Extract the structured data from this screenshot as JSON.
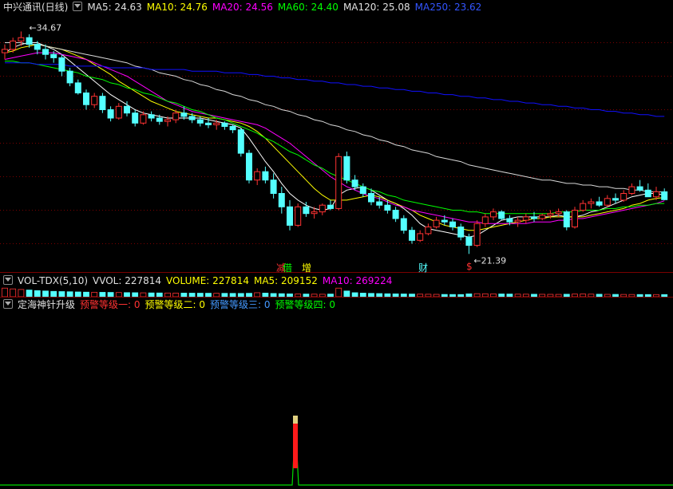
{
  "colors": {
    "ma5": "#ffff00",
    "ma10": "#ffff00",
    "ma20": "#ff00ff",
    "ma60": "#00ff00",
    "ma120": "#d0d0d0",
    "ma250": "#0000ff",
    "up": "#ff3232",
    "down": "#54ffff",
    "grid": "#7a0000"
  },
  "main_panel": {
    "stock_name": "中兴通讯(日线)",
    "ma5": "MA5: 24.63",
    "ma10": "MA10: 24.76",
    "ma20": "MA20: 24.56",
    "ma60": "MA60: 24.40",
    "ma120": "MA120: 25.08",
    "ma250": "MA250: 23.62",
    "high_label": "34.67",
    "low_label": "21.39",
    "markers": [
      "减",
      "借",
      "增",
      "财",
      "$"
    ]
  },
  "vol_panel": {
    "title": "VOL-TDX(5,10)",
    "vvol": "VVOL: 227814",
    "volume": "VOLUME: 227814",
    "ma5": "MA5: 209152",
    "ma10": "MA10: 269224"
  },
  "ind_panel": {
    "title": "定海神针升级",
    "w1": "预警等级一: 0",
    "w2": "预警等级二: 0",
    "w3": "预警等级三: 0",
    "w4": "预警等级四: 0"
  },
  "chart_data": [
    {
      "type": "candlestick",
      "title": "中兴通讯(日线)",
      "ylim": [
        20.5,
        35.5
      ],
      "high": 34.67,
      "low": 21.39,
      "candles": [
        [
          33.4,
          33.9,
          33.0,
          33.6
        ],
        [
          33.6,
          34.3,
          33.4,
          34.1
        ],
        [
          34.1,
          34.67,
          33.8,
          34.3
        ],
        [
          34.3,
          34.5,
          33.7,
          33.9
        ],
        [
          33.9,
          34.1,
          33.3,
          33.6
        ],
        [
          33.6,
          33.9,
          33.0,
          33.3
        ],
        [
          33.3,
          33.5,
          32.8,
          33.1
        ],
        [
          33.1,
          33.3,
          32.0,
          32.3
        ],
        [
          32.3,
          32.5,
          31.4,
          31.6
        ],
        [
          31.6,
          31.8,
          30.9,
          31.0
        ],
        [
          31.0,
          31.2,
          30.0,
          30.3
        ],
        [
          30.3,
          31.0,
          30.1,
          30.8
        ],
        [
          30.8,
          31.0,
          29.8,
          30.0
        ],
        [
          30.0,
          30.2,
          29.3,
          29.5
        ],
        [
          29.5,
          30.4,
          29.4,
          30.2
        ],
        [
          30.2,
          30.5,
          29.6,
          29.8
        ],
        [
          29.8,
          30.0,
          29.0,
          29.2
        ],
        [
          29.2,
          29.9,
          29.1,
          29.7
        ],
        [
          29.7,
          29.9,
          29.3,
          29.5
        ],
        [
          29.5,
          29.7,
          29.1,
          29.3
        ],
        [
          29.3,
          29.6,
          29.0,
          29.4
        ],
        [
          29.4,
          30.0,
          29.2,
          29.8
        ],
        [
          29.8,
          30.2,
          29.4,
          29.6
        ],
        [
          29.6,
          29.8,
          29.2,
          29.4
        ],
        [
          29.4,
          29.6,
          29.0,
          29.2
        ],
        [
          29.2,
          29.5,
          28.9,
          29.1
        ],
        [
          29.1,
          29.4,
          28.8,
          29.2
        ],
        [
          29.2,
          29.3,
          28.8,
          29.0
        ],
        [
          29.0,
          29.1,
          28.6,
          28.8
        ],
        [
          28.8,
          28.9,
          27.2,
          27.4
        ],
        [
          27.4,
          27.6,
          25.6,
          25.8
        ],
        [
          25.8,
          26.5,
          25.5,
          26.3
        ],
        [
          26.3,
          26.6,
          25.6,
          25.8
        ],
        [
          25.8,
          26.2,
          24.7,
          25.0
        ],
        [
          25.0,
          25.4,
          23.8,
          24.2
        ],
        [
          24.2,
          24.6,
          22.8,
          23.1
        ],
        [
          23.1,
          24.4,
          23.0,
          24.2
        ],
        [
          24.2,
          24.5,
          23.6,
          23.8
        ],
        [
          23.8,
          24.2,
          23.5,
          23.9
        ],
        [
          23.9,
          24.4,
          23.7,
          24.3
        ],
        [
          24.3,
          24.6,
          24.0,
          24.1
        ],
        [
          24.1,
          27.4,
          24.0,
          27.2
        ],
        [
          27.2,
          27.5,
          25.6,
          25.8
        ],
        [
          25.8,
          26.1,
          25.2,
          25.4
        ],
        [
          25.4,
          25.6,
          24.8,
          25.0
        ],
        [
          25.0,
          25.3,
          24.3,
          24.5
        ],
        [
          24.5,
          24.8,
          24.1,
          24.3
        ],
        [
          24.3,
          24.6,
          23.8,
          24.0
        ],
        [
          24.0,
          24.2,
          23.3,
          23.5
        ],
        [
          23.5,
          23.7,
          22.6,
          22.8
        ],
        [
          22.8,
          23.0,
          22.0,
          22.2
        ],
        [
          22.2,
          22.8,
          22.1,
          22.6
        ],
        [
          22.6,
          23.2,
          22.5,
          23.0
        ],
        [
          23.0,
          23.6,
          22.9,
          23.4
        ],
        [
          23.4,
          23.7,
          23.1,
          23.3
        ],
        [
          23.3,
          23.5,
          22.8,
          23.0
        ],
        [
          23.0,
          23.2,
          22.2,
          22.4
        ],
        [
          22.4,
          22.6,
          21.39,
          21.9
        ],
        [
          21.9,
          23.4,
          21.8,
          23.2
        ],
        [
          23.2,
          23.8,
          23.0,
          23.6
        ],
        [
          23.6,
          24.1,
          23.4,
          23.9
        ],
        [
          23.9,
          24.0,
          23.4,
          23.5
        ],
        [
          23.5,
          23.7,
          23.1,
          23.3
        ],
        [
          23.3,
          23.6,
          23.0,
          23.4
        ],
        [
          23.4,
          23.8,
          23.2,
          23.6
        ],
        [
          23.6,
          23.9,
          23.3,
          23.5
        ],
        [
          23.5,
          23.8,
          23.4,
          23.7
        ],
        [
          23.7,
          24.0,
          23.5,
          23.8
        ],
        [
          23.8,
          24.1,
          23.6,
          23.9
        ],
        [
          23.9,
          24.0,
          22.8,
          23.0
        ],
        [
          23.0,
          24.2,
          22.9,
          24.0
        ],
        [
          24.0,
          24.6,
          23.9,
          24.4
        ],
        [
          24.4,
          24.7,
          24.1,
          24.5
        ],
        [
          24.5,
          24.8,
          24.2,
          24.3
        ],
        [
          24.3,
          24.9,
          24.2,
          24.7
        ],
        [
          24.7,
          25.0,
          24.4,
          24.6
        ],
        [
          24.6,
          25.2,
          24.5,
          25.0
        ],
        [
          25.0,
          25.6,
          24.9,
          25.4
        ],
        [
          25.4,
          25.8,
          25.1,
          25.2
        ],
        [
          25.2,
          25.6,
          24.9,
          24.8
        ],
        [
          24.8,
          25.4,
          24.6,
          25.1
        ],
        [
          25.1,
          25.3,
          24.6,
          24.63
        ]
      ],
      "ma_series": [
        {
          "name": "MA5",
          "values": [
            33.4,
            33.7,
            33.9,
            34.0,
            34.0,
            33.8,
            33.6,
            33.3,
            32.9,
            32.5,
            32.1,
            31.7,
            31.3,
            30.9,
            30.6,
            30.3,
            30.0,
            29.8,
            29.7,
            29.6,
            29.5,
            29.5,
            29.5,
            29.5,
            29.5,
            29.4,
            29.3,
            29.2,
            29.1,
            28.9,
            28.3,
            27.6,
            26.9,
            26.3,
            25.6,
            25.0,
            24.6,
            24.3,
            24.1,
            24.0,
            24.1,
            24.9,
            25.2,
            25.3,
            25.4,
            25.2,
            24.9,
            24.6,
            24.4,
            24.1,
            23.7,
            23.2,
            22.9,
            22.8,
            22.7,
            22.6,
            22.5,
            22.4,
            22.5,
            22.8,
            23.1,
            23.4,
            23.5,
            23.6,
            23.6,
            23.6,
            23.6,
            23.6,
            23.7,
            23.6,
            23.6,
            23.7,
            23.9,
            24.0,
            24.2,
            24.4,
            24.6,
            24.8,
            24.9,
            25.0,
            25.0,
            24.9
          ]
        },
        {
          "name": "MA10",
          "values": [
            33.4,
            33.5,
            33.7,
            33.8,
            33.9,
            33.8,
            33.7,
            33.6,
            33.4,
            33.2,
            33.0,
            32.7,
            32.4,
            32.1,
            31.7,
            31.4,
            31.1,
            30.8,
            30.5,
            30.3,
            30.1,
            29.9,
            29.8,
            29.7,
            29.6,
            29.5,
            29.5,
            29.4,
            29.3,
            29.2,
            29.0,
            28.7,
            28.3,
            27.8,
            27.3,
            26.8,
            26.3,
            25.8,
            25.3,
            24.9,
            24.6,
            24.6,
            24.6,
            24.7,
            24.8,
            24.9,
            24.8,
            24.6,
            24.4,
            24.2,
            24.0,
            23.7,
            23.5,
            23.3,
            23.1,
            23.0,
            22.9,
            22.8,
            22.8,
            22.9,
            23.0,
            23.1,
            23.2,
            23.3,
            23.4,
            23.5,
            23.5,
            23.6,
            23.6,
            23.6,
            23.6,
            23.6,
            23.7,
            23.8,
            23.9,
            24.0,
            24.1,
            24.3,
            24.4,
            24.6,
            24.7,
            24.76
          ]
        },
        {
          "name": "MA20",
          "values": [
            33.0,
            33.1,
            33.2,
            33.3,
            33.4,
            33.4,
            33.4,
            33.3,
            33.2,
            33.1,
            33.0,
            32.8,
            32.6,
            32.4,
            32.2,
            32.0,
            31.7,
            31.4,
            31.1,
            30.8,
            30.5,
            30.3,
            30.1,
            29.9,
            29.8,
            29.7,
            29.6,
            29.5,
            29.4,
            29.3,
            29.2,
            29.1,
            28.9,
            28.6,
            28.3,
            28.0,
            27.6,
            27.2,
            26.8,
            26.4,
            26.0,
            25.7,
            25.4,
            25.2,
            25.0,
            24.8,
            24.7,
            24.5,
            24.3,
            24.2,
            24.0,
            23.9,
            23.8,
            23.7,
            23.6,
            23.5,
            23.4,
            23.3,
            23.3,
            23.2,
            23.2,
            23.2,
            23.2,
            23.2,
            23.2,
            23.3,
            23.3,
            23.3,
            23.4,
            23.4,
            23.5,
            23.5,
            23.6,
            23.7,
            23.8,
            23.9,
            24.0,
            24.1,
            24.2,
            24.3,
            24.4,
            24.56
          ]
        },
        {
          "name": "MA60",
          "values": [
            32.9,
            32.9,
            32.8,
            32.8,
            32.7,
            32.6,
            32.5,
            32.4,
            32.3,
            32.2,
            32.0,
            31.9,
            31.8,
            31.6,
            31.5,
            31.3,
            31.2,
            31.0,
            30.9,
            30.7,
            30.5,
            30.4,
            30.2,
            30.0,
            29.9,
            29.7,
            29.5,
            29.4,
            29.2,
            29.0,
            28.8,
            28.6,
            28.3,
            28.1,
            27.8,
            27.5,
            27.3,
            27.0,
            26.7,
            26.5,
            26.2,
            26.0,
            25.8,
            25.6,
            25.4,
            25.2,
            25.1,
            24.9,
            24.8,
            24.6,
            24.5,
            24.4,
            24.3,
            24.2,
            24.1,
            24.0,
            24.0,
            23.9,
            23.9,
            23.8,
            23.8,
            23.8,
            23.8,
            23.8,
            23.8,
            23.8,
            23.8,
            23.8,
            23.9,
            23.9,
            23.9,
            24.0,
            24.0,
            24.0,
            24.1,
            24.1,
            24.2,
            24.2,
            24.3,
            24.3,
            24.4,
            24.4
          ]
        },
        {
          "name": "MA120",
          "values": [
            34.0,
            34.0,
            34.0,
            33.9,
            33.9,
            33.8,
            33.7,
            33.6,
            33.5,
            33.4,
            33.3,
            33.2,
            33.1,
            33.0,
            32.9,
            32.8,
            32.6,
            32.5,
            32.4,
            32.2,
            32.1,
            32.0,
            31.8,
            31.7,
            31.5,
            31.4,
            31.2,
            31.1,
            30.9,
            30.8,
            30.6,
            30.5,
            30.3,
            30.2,
            30.0,
            29.9,
            29.7,
            29.6,
            29.4,
            29.3,
            29.1,
            29.0,
            28.8,
            28.7,
            28.5,
            28.4,
            28.2,
            28.1,
            27.9,
            27.8,
            27.6,
            27.5,
            27.4,
            27.2,
            27.1,
            27.0,
            26.9,
            26.7,
            26.6,
            26.5,
            26.4,
            26.3,
            26.2,
            26.1,
            26.0,
            25.9,
            25.8,
            25.8,
            25.7,
            25.6,
            25.6,
            25.5,
            25.5,
            25.4,
            25.4,
            25.3,
            25.3,
            25.2,
            25.2,
            25.1,
            25.1,
            25.08
          ]
        },
        {
          "name": "MA250",
          "values": [
            32.8,
            32.8,
            32.8,
            32.8,
            32.7,
            32.7,
            32.7,
            32.7,
            32.6,
            32.6,
            32.6,
            32.6,
            32.6,
            32.5,
            32.5,
            32.5,
            32.5,
            32.5,
            32.4,
            32.4,
            32.4,
            32.4,
            32.4,
            32.3,
            32.3,
            32.3,
            32.3,
            32.2,
            32.2,
            32.2,
            32.1,
            32.1,
            32.0,
            32.0,
            31.9,
            31.9,
            31.8,
            31.8,
            31.7,
            31.7,
            31.6,
            31.6,
            31.5,
            31.5,
            31.4,
            31.4,
            31.3,
            31.3,
            31.2,
            31.2,
            31.1,
            31.1,
            31.0,
            31.0,
            30.9,
            30.9,
            30.8,
            30.8,
            30.7,
            30.7,
            30.6,
            30.6,
            30.5,
            30.5,
            30.4,
            30.4,
            30.3,
            30.3,
            30.2,
            30.2,
            30.1,
            30.1,
            30.0,
            30.0,
            29.9,
            29.9,
            29.8,
            29.8,
            29.7,
            29.7,
            29.6,
            29.6
          ]
        }
      ]
    },
    {
      "type": "bar",
      "title": "VOL-TDX(5,10)",
      "ylim": [
        0,
        1000000
      ],
      "values": [
        900000,
        820000,
        760000,
        700000,
        640000,
        600000,
        560000,
        540000,
        520000,
        500000,
        480000,
        470000,
        460000,
        450000,
        440000,
        430000,
        420000,
        410000,
        400000,
        395000,
        390000,
        385000,
        380000,
        375000,
        370000,
        365000,
        360000,
        355000,
        350000,
        345000,
        360000,
        420000,
        380000,
        340000,
        320000,
        300000,
        290000,
        280000,
        270000,
        260000,
        280000,
        900000,
        600000,
        420000,
        380000,
        350000,
        330000,
        310000,
        300000,
        290000,
        280000,
        270000,
        260000,
        250000,
        240000,
        235000,
        230000,
        300000,
        320000,
        310000,
        300000,
        290000,
        280000,
        270000,
        265000,
        260000,
        255000,
        250000,
        245000,
        260000,
        280000,
        290000,
        270000,
        260000,
        250000,
        245000,
        240000,
        235000,
        230000,
        228000,
        227814,
        227814
      ]
    },
    {
      "type": "line",
      "title": "定海神针升级",
      "ylim": [
        0,
        1
      ],
      "values": [
        0,
        0,
        0,
        0,
        0,
        0,
        0,
        0,
        0,
        0,
        0,
        0,
        0,
        0,
        0,
        0,
        0,
        0,
        0,
        0,
        0,
        0,
        0,
        0,
        0,
        0,
        0,
        0,
        0,
        0,
        0,
        0,
        0,
        0,
        0,
        1,
        0,
        0,
        0,
        0,
        0,
        0,
        0,
        0,
        0,
        0,
        0,
        0,
        0,
        0,
        0,
        0,
        0,
        0,
        0,
        0,
        0,
        0,
        0,
        0,
        0,
        0,
        0,
        0,
        0,
        0,
        0,
        0,
        0,
        0,
        0,
        0,
        0,
        0,
        0,
        0,
        0,
        0,
        0,
        0,
        0,
        0
      ]
    }
  ]
}
